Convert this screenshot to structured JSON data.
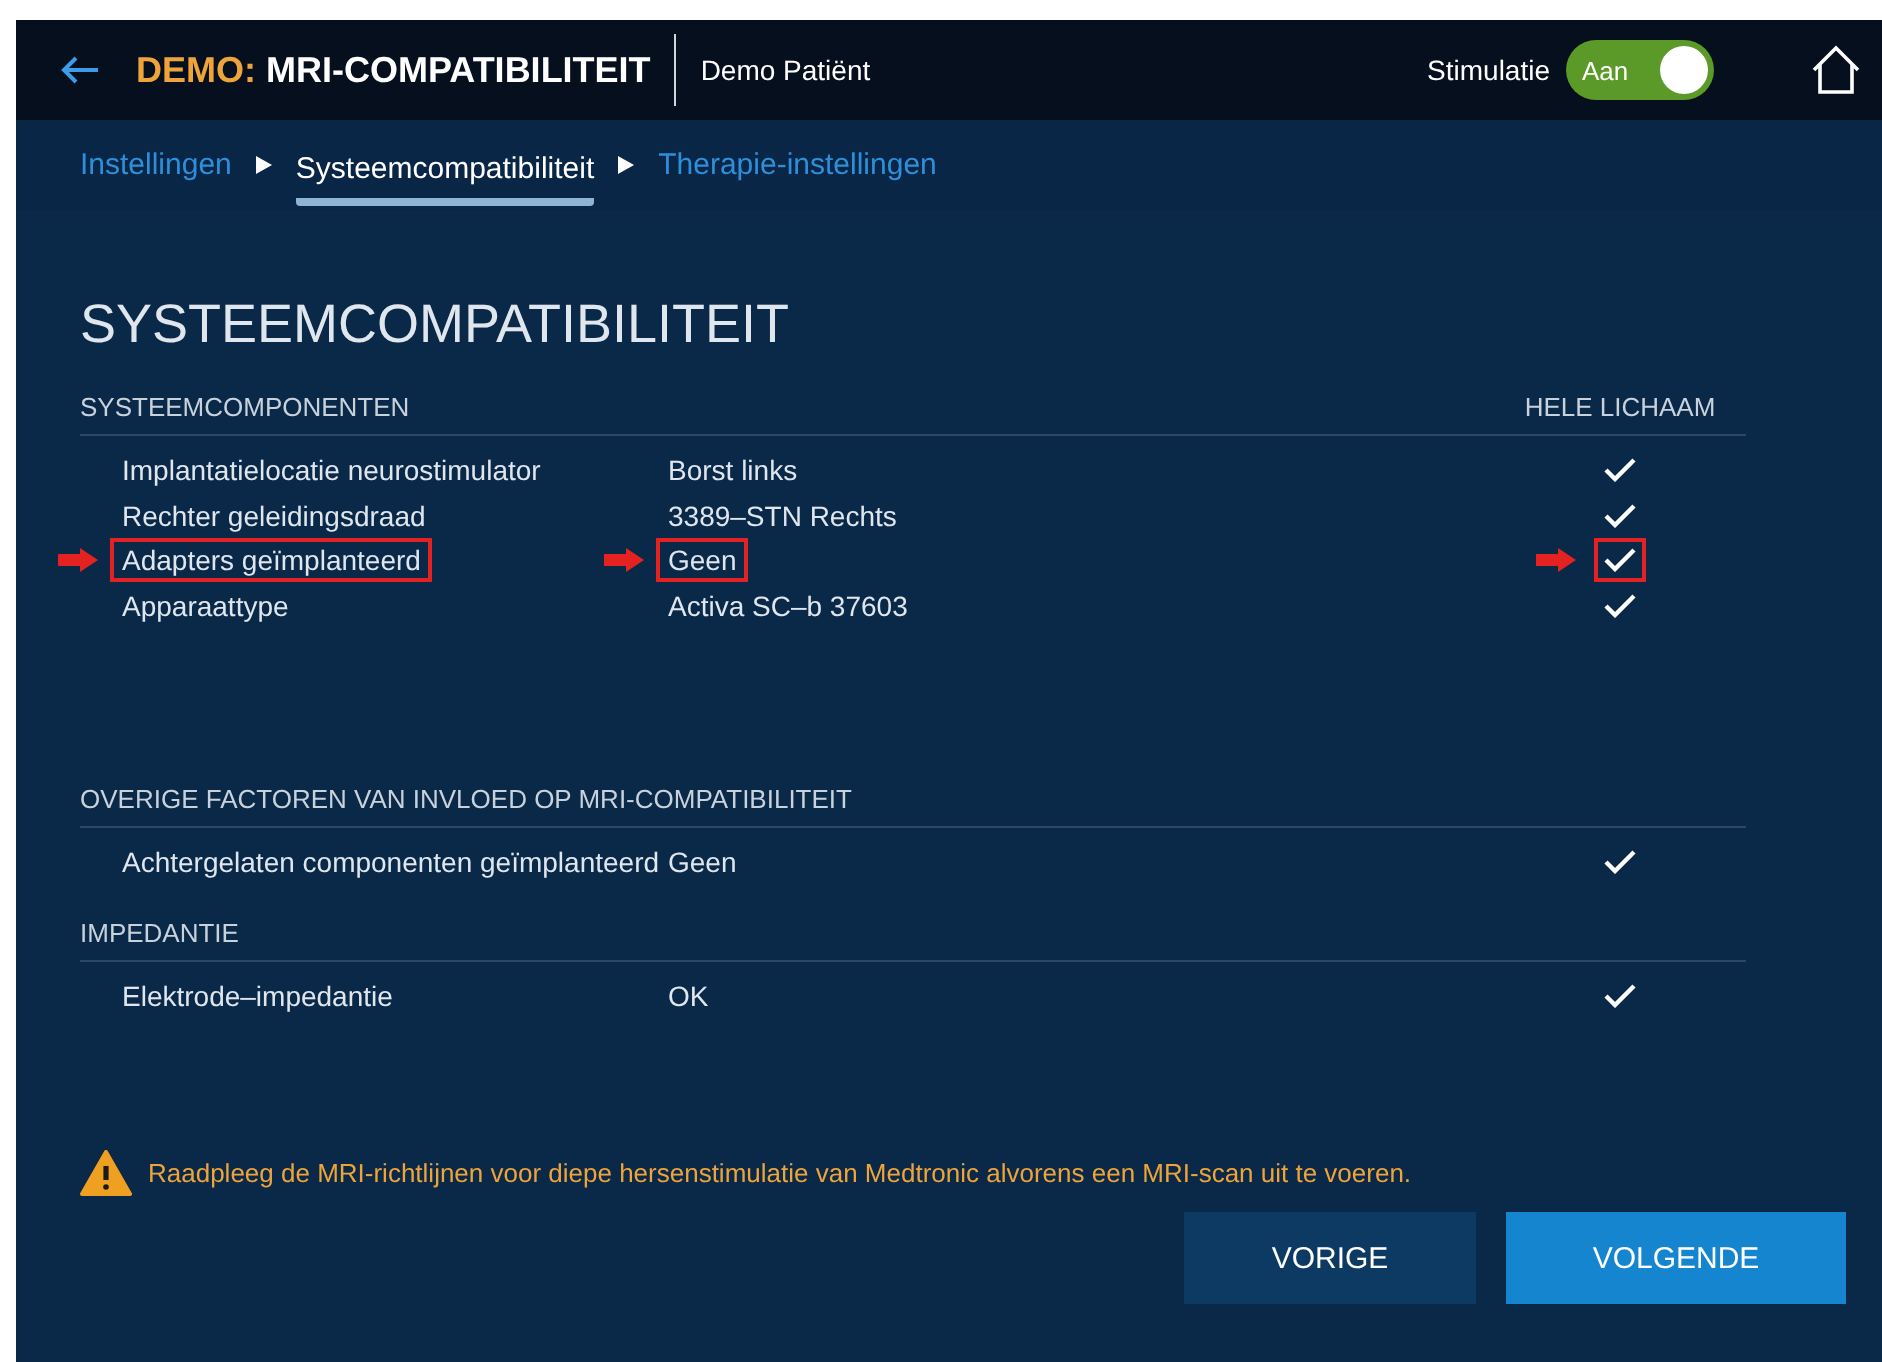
{
  "header": {
    "title_prefix": "DEMO:",
    "title": "MRI-COMPATIBILITEIT",
    "patient": "Demo Patiënt",
    "stimulation_label": "Stimulatie",
    "stimulation_toggle": {
      "label": "Aan",
      "on": true
    }
  },
  "breadcrumb": [
    {
      "label": "Instellingen",
      "selected": false
    },
    {
      "label": "Systeemcompatibiliteit",
      "selected": true
    },
    {
      "label": "Therapie-instellingen",
      "selected": false
    }
  ],
  "page_title": "SYSTEEMCOMPATIBILITEIT",
  "sections": [
    {
      "title": "SYSTEEMCOMPONENTEN",
      "column_heading": "HELE LICHAAM",
      "rows": [
        {
          "label": "Implantatielocatie neurostimulator",
          "value": "Borst links",
          "checked": true,
          "highlighted": false
        },
        {
          "label": "Rechter geleidingsdraad",
          "value": "3389–STN Rechts",
          "checked": true,
          "highlighted": false
        },
        {
          "label": "Adapters geïmplanteerd",
          "value": "Geen",
          "checked": true,
          "highlighted": true
        },
        {
          "label": "Apparaattype",
          "value": "Activa SC–b 37603",
          "checked": true,
          "highlighted": false
        }
      ]
    },
    {
      "title": "OVERIGE FACTOREN VAN INVLOED OP MRI-COMPATIBILITEIT",
      "rows": [
        {
          "label": "Achtergelaten componenten geïmplanteerd",
          "value": "Geen",
          "checked": true,
          "highlighted": false
        }
      ]
    },
    {
      "title": "IMPEDANTIE",
      "rows": [
        {
          "label": "Elektrode–impedantie",
          "value": "OK",
          "checked": true,
          "highlighted": false
        }
      ]
    }
  ],
  "warning": "Raadpleeg de MRI-richtlijnen voor diepe hersenstimulatie van Medtronic alvorens een MRI-scan uit te voeren.",
  "buttons": [
    {
      "label": "VORIGE",
      "kind": "secondary"
    },
    {
      "label": "VOLGENDE",
      "kind": "primary"
    }
  ]
}
